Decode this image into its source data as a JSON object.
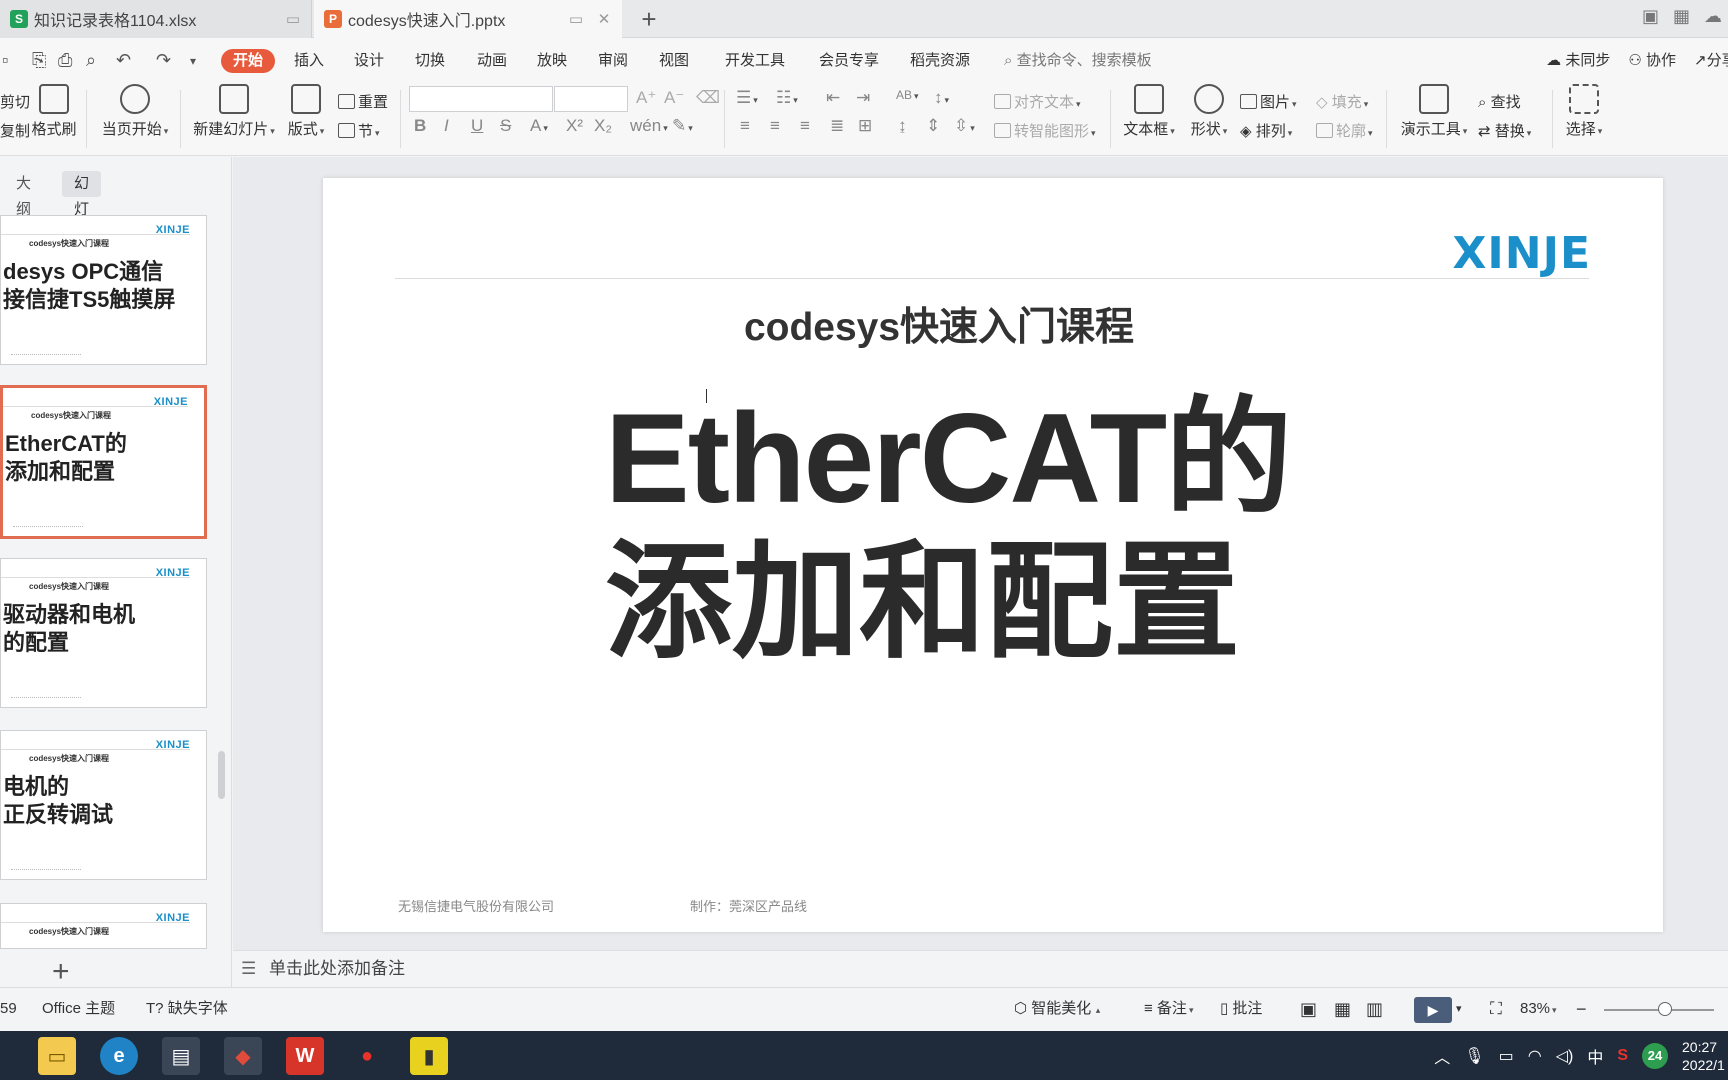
{
  "tabs": [
    {
      "icon": "S",
      "title": "知识记录表格1104.xlsx",
      "color": "#22a15b"
    },
    {
      "icon": "P",
      "title": "codesys快速入门.pptx",
      "color": "#e86d3a"
    }
  ],
  "menu": {
    "items": [
      "开始",
      "插入",
      "设计",
      "切换",
      "动画",
      "放映",
      "审阅",
      "视图",
      "开发工具",
      "会员专享",
      "稻壳资源"
    ],
    "search_placeholder": "查找命令、搜索模板",
    "sync": "未同步",
    "collab": "协作",
    "share": "分享"
  },
  "ribbon": {
    "cut": "剪切",
    "copy": "复制",
    "format_painter": "格式刷",
    "from_current": "当页开始",
    "new_slide": "新建幻灯片",
    "layout": "版式",
    "reset": "重置",
    "section": "节",
    "align_text": "对齐文本",
    "to_smartart": "转智能图形",
    "textbox": "文本框",
    "shape": "形状",
    "picture": "图片",
    "fill": "填充",
    "arrange": "排列",
    "outline": "轮廓",
    "present_tools": "演示工具",
    "find": "查找",
    "replace": "替换",
    "select": "选择"
  },
  "panel": {
    "outline_tab": "大纲",
    "slides_tab": "幻灯片"
  },
  "thumbnails": [
    {
      "logo": "XINJE",
      "sub": "codesys快速入门课程",
      "line1": "desys OPC通信",
      "line2": "接信捷TS5触摸屏",
      "selected": false
    },
    {
      "logo": "XINJE",
      "sub": "codesys快速入门课程",
      "line1": "EtherCAT的",
      "line2": "添加和配置",
      "selected": true
    },
    {
      "logo": "XINJE",
      "sub": "codesys快速入门课程",
      "line1": "驱动器和电机",
      "line2": "的配置",
      "selected": false
    },
    {
      "logo": "XINJE",
      "sub": "codesys快速入门课程",
      "line1": "电机的",
      "line2": "正反转调试",
      "selected": false
    },
    {
      "logo": "XINJE",
      "sub": "codesys快速入门课程",
      "line1": "",
      "line2": "",
      "selected": false
    }
  ],
  "slide": {
    "logo": "XINJE",
    "subtitle": "codesys快速入门课程",
    "title_line1": "EtherCAT的",
    "title_line2": "添加和配置",
    "footer_company": "无锡信捷电气股份有限公司",
    "footer_author": "制作：莞深区产品线"
  },
  "notes_placeholder": "单击此处添加备注",
  "status": {
    "page": "59",
    "theme": "Office 主题",
    "missing_font": "缺失字体",
    "beautify": "智能美化",
    "notes": "备注",
    "comment": "批注",
    "zoom": "83%",
    "zoom_fraction": 0.55
  },
  "taskbar": {
    "ime": "中",
    "badge": "24",
    "time": "20:27",
    "date": "2022/1"
  }
}
